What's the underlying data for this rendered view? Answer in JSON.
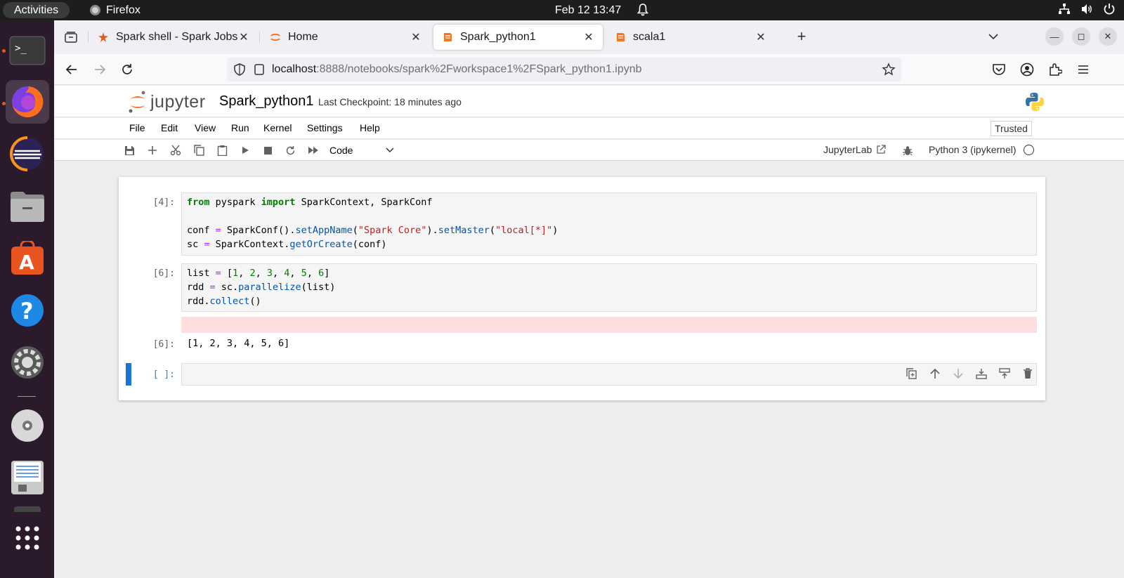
{
  "topbar": {
    "activities": "Activities",
    "app_name": "Firefox",
    "clock": "Feb 12  13:47"
  },
  "dock": {
    "apps": [
      "terminal",
      "firefox",
      "eclipse",
      "files",
      "app-center",
      "help",
      "settings",
      "disc",
      "text-editor",
      "show-apps"
    ]
  },
  "browser": {
    "tabs": [
      {
        "title": "Spark shell - Spark Jobs",
        "favicon": "spark-icon"
      },
      {
        "title": "Home",
        "favicon": "jupyter-icon"
      },
      {
        "title": "Spark_python1",
        "favicon": "notebook-icon",
        "selected": true
      },
      {
        "title": "scala1",
        "favicon": "notebook-icon"
      }
    ],
    "url_host": "localhost",
    "url_path": ":8888/notebooks/spark%2Fworkspace1%2FSpark_python1.ipynb"
  },
  "jupyter": {
    "logo_text": "jupyter",
    "notebook_title": "Spark_python1",
    "checkpoint": "Last Checkpoint: 18 minutes ago",
    "menu": [
      "File",
      "Edit",
      "View",
      "Run",
      "Kernel",
      "Settings",
      "Help"
    ],
    "trusted": "Trusted",
    "cell_type": "Code",
    "jupyterlab": "JupyterLab",
    "kernel": "Python 3 (ipykernel)",
    "cells": [
      {
        "prompt": "[4]:"
      },
      {
        "prompt": "[6]:"
      },
      {
        "output_prompt": "[6]:",
        "output": "[1, 2, 3, 4, 5, 6]"
      },
      {
        "prompt": "[ ]:"
      }
    ]
  },
  "colors": {
    "accent": "#1976d2",
    "stderr_bg": "#fddddd",
    "jupyter_orange": "#f37726"
  }
}
